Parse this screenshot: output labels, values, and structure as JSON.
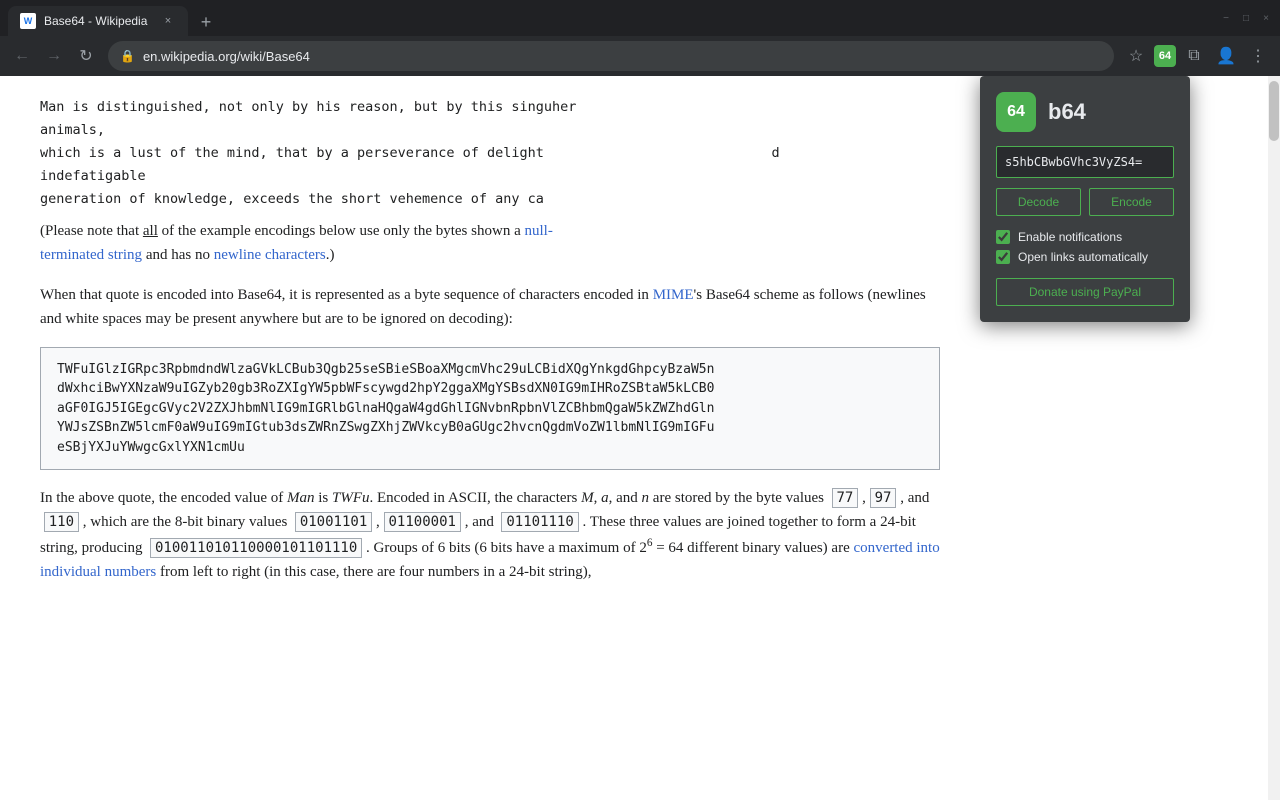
{
  "browser": {
    "tab": {
      "favicon_text": "W",
      "title": "Base64 - Wikipedia",
      "close_label": "×"
    },
    "new_tab_label": "+",
    "window_controls": {
      "minimize": "−",
      "maximize": "□",
      "close": "×"
    },
    "nav": {
      "back_label": "←",
      "forward_label": "→",
      "refresh_label": "↻",
      "address": "en.wikipedia.org/wiki/Base64",
      "star_label": "☆",
      "extensions_label": "⧉",
      "menu_label": "⋮"
    }
  },
  "ext_popup": {
    "logo_text": "64",
    "name": "b64",
    "input_value": "s5hbCBwbGVhc3VyZS4=",
    "decode_label": "Decode",
    "encode_label": "Encode",
    "checkbox1_label": "Enable notifications",
    "checkbox2_label": "Open links automatically",
    "donate_label": "Donate using PayPal"
  },
  "page": {
    "para1": "(Please note that all of the example encodings below use only the bytes shown in",
    "para1_link1": "null-terminated string",
    "para1_link2": "newline characters",
    "para1_suffix": " and has no",
    "para1_end": ".)",
    "para2_start": "When that quote is encoded into Base64, it is represented as a byte sequence of",
    "para2_end": "characters encoded in",
    "para2_mime": "MIME",
    "para2_rest": "'s Base64 scheme as follows (newlines and white spaces may be present anywhere but are to be ignored on decoding):",
    "code_block": "TWFuIGlzIGRpc3RpbmdndWlzaGVkLCBub3Qgb25seSBieSBoaXMgcmVhc29uLCBidXQgYnkgdGhpcyBzaW5ndWxhciBwYXNzaW9uIGZyb20gb3RoZXIgYW5pbWFscywgd2hpY2ggaXMgYSBsdXN0IG9mIHRoZSBtaW5kLCB0aGF0IGJ5IGEgcGVyc2V2ZXJhbmNlIG9mIGRlbGlnaHQgaW4gdGhlIGNvbnRpbnVlZCBhbmQgaW5kZWZhdGlnYWJsZSBnZW5lcmF0aW9uIG9mIGtub3dsZWRnZSwgZXhjZWVkcyB0aGUgc2hvcnQgdmVoZW1lbmNlIG9mIGFueSBjYXJuYWwgcGxlYXN1cmUu",
    "para3_start": "In the above quote, the encoded value of",
    "para3_man": "Man",
    "para3_mid": "is",
    "para3_twfu": "TWFu",
    "para3_rest": ". Encoded in ASCII, the characters",
    "para3_m": "M",
    "para3_comma": ",",
    "para3_a": "a",
    "para3_and": ", and",
    "para3_n": "n",
    "para3_bytes": "are stored by the byte values",
    "val_m": "77",
    "val_a": "97",
    "val_n": "110",
    "para3_which": ", which are the 8-bit binary values",
    "bin_m": "01001101",
    "bin_a": "01100001",
    "bin_n": "01101110",
    "para3_joined": ". These three values are joined together to form a 24-bit string, producing",
    "bin_combined": "010011010110000101101110",
    "para3_groups": ". Groups of 6 bits (6 bits have a maximum of 2",
    "para3_exp": "6",
    "para3_equals": "= 64 different binary values)",
    "para3_final": "are",
    "para3_link": "converted into individual numbers",
    "para3_end": "from left to right (in this case, there are four numbers in a 24-bit string),",
    "page_text_top1": "Man is distinguished, not only by his reason, but by this singu",
    "page_text_top2": "animals,",
    "page_text_top3": "which is a lust of the mind, that by a perseverance of delight",
    "page_text_top4": "indefatigable",
    "page_text_top5": "generation of knowledge, exceeds the short vehemence of any ca"
  }
}
